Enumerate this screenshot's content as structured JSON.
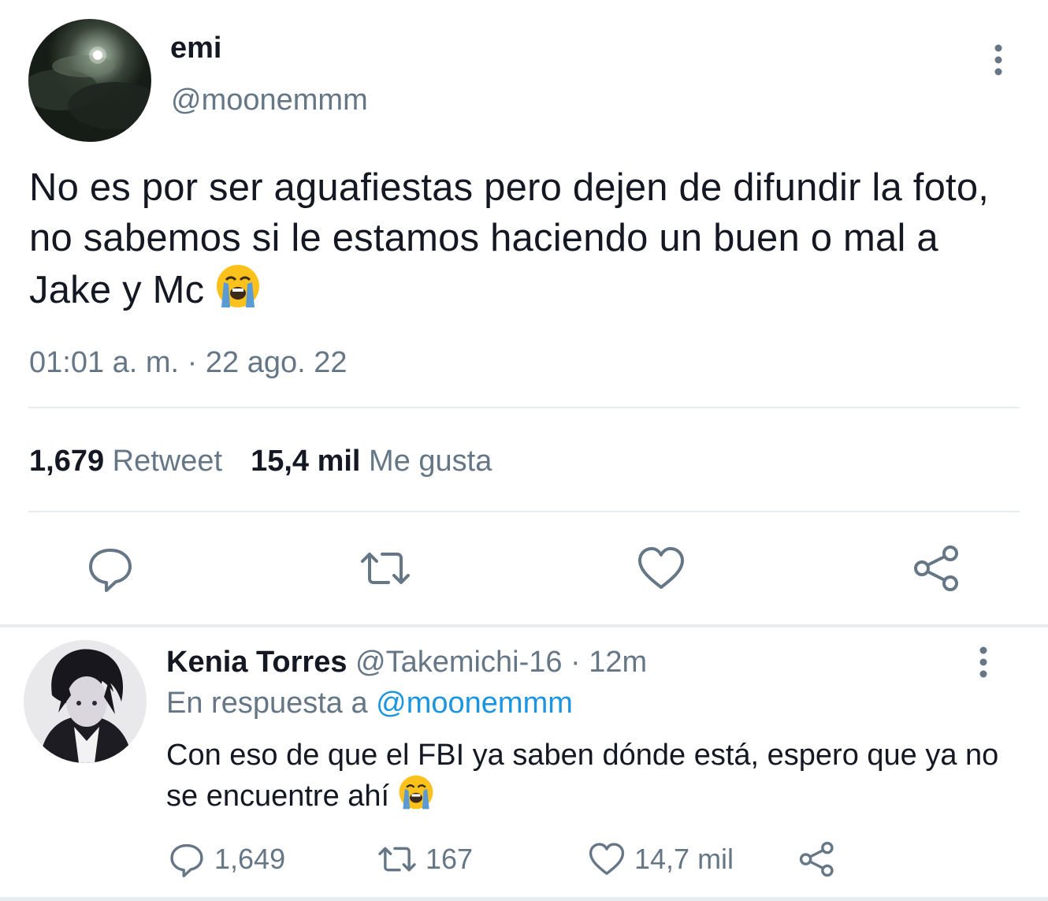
{
  "main_tweet": {
    "author_name": "emi",
    "author_handle": "@moonemmm",
    "text": "No es por ser aguafiestas pero dejen de difundir la foto, no sabemos si le estamos haciendo un buen o mal a Jake y Mc",
    "text_emoji": "loudly-crying-face",
    "timestamp": "01:01 a. m. · 22 ago. 22",
    "retweet_count": "1,679",
    "retweet_label": "Retweet",
    "like_count": "15,4 mil",
    "like_label": "Me gusta"
  },
  "reply_tweet": {
    "author_name": "Kenia Torres",
    "author_handle": "@Takemichi-16",
    "time_ago": "· 12m",
    "in_reply_to_label": "En respuesta a",
    "in_reply_to_handle": "@moonemmm",
    "text": "Con eso de que el FBI ya saben dónde está, espero que ya no se encuentre ahí",
    "text_emoji": "loudly-crying-face",
    "reply_count": "1,649",
    "retweet_count": "167",
    "like_count": "14,7 mil"
  },
  "icons": {
    "reply": "speech-bubble-icon",
    "retweet": "retweet-icon",
    "like": "heart-icon",
    "share": "share-icon",
    "more": "vertical-dots-icon"
  },
  "colors": {
    "text": "#141823",
    "secondary": "#657786",
    "link": "#1b95e0",
    "divider": "#e6ecf0"
  }
}
